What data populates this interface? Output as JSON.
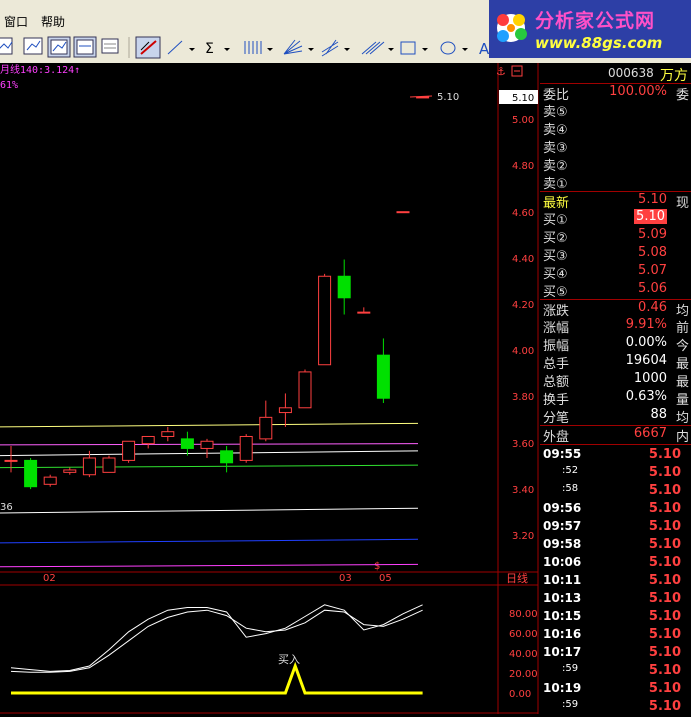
{
  "menu": {
    "window": "窗口",
    "help": "帮助"
  },
  "logo": {
    "title": "分析家公式网",
    "url": "www.88gs.com"
  },
  "header": {
    "ma_label": "月线140:3.124↑",
    "pct_label": "61%",
    "sell_icon": "sell-marker-icon"
  },
  "price_axis": {
    "labels": [
      "5.10",
      "5.00",
      "4.80",
      "4.60",
      "4.40",
      "4.20",
      "4.00",
      "3.80",
      "3.60",
      "3.40",
      "3.20"
    ]
  },
  "time_axis": {
    "labels": [
      "02",
      "03",
      "05"
    ],
    "period": "日线"
  },
  "left_edge_label": "36",
  "indicator": {
    "signal_label": "买入",
    "axis_labels": [
      "80.00",
      "60.00",
      "40.00",
      "20.00",
      "0.00"
    ]
  },
  "quote": {
    "code": "000638",
    "name": "万方",
    "weibi": {
      "label": "委比",
      "value": "100.00%",
      "ext": "委"
    },
    "sells": [
      {
        "label": "卖⑤",
        "price": ""
      },
      {
        "label": "卖④",
        "price": ""
      },
      {
        "label": "卖③",
        "price": ""
      },
      {
        "label": "卖②",
        "price": ""
      },
      {
        "label": "卖①",
        "price": ""
      }
    ],
    "latest": {
      "label": "最新",
      "value": "5.10",
      "ext": "现"
    },
    "buys": [
      {
        "label": "买①",
        "price": "5.10"
      },
      {
        "label": "买②",
        "price": "5.09"
      },
      {
        "label": "买③",
        "price": "5.08"
      },
      {
        "label": "买④",
        "price": "5.07"
      },
      {
        "label": "买⑤",
        "price": "5.06"
      }
    ],
    "stats": [
      {
        "label": "涨跌",
        "value": "0.46",
        "ext": "均",
        "color": "#ff4040"
      },
      {
        "label": "涨幅",
        "value": "9.91%",
        "ext": "前",
        "color": "#ff4040"
      },
      {
        "label": "振幅",
        "value": "0.00%",
        "ext": "今",
        "color": "#ffffff"
      },
      {
        "label": "总手",
        "value": "19604",
        "ext": "最",
        "color": "#ffffff"
      },
      {
        "label": "总额",
        "value": "1000",
        "ext": "最",
        "color": "#ffffff"
      },
      {
        "label": "换手",
        "value": "0.63%",
        "ext": "量",
        "color": "#ffffff"
      },
      {
        "label": "分笔",
        "value": "88",
        "ext": "均",
        "color": "#ffffff"
      },
      {
        "label": "外盘",
        "value": "6667",
        "ext": "内",
        "color": "#ff4040"
      }
    ],
    "ticks": [
      {
        "time": "09:55",
        "price": "5.10"
      },
      {
        "time": ":52",
        "price": "5.10"
      },
      {
        "time": ":58",
        "price": "5.10"
      },
      {
        "time": "09:56",
        "price": "5.10"
      },
      {
        "time": "09:57",
        "price": "5.10"
      },
      {
        "time": "09:58",
        "price": "5.10"
      },
      {
        "time": "10:06",
        "price": "5.10"
      },
      {
        "time": "10:11",
        "price": "5.10"
      },
      {
        "time": "10:13",
        "price": "5.10"
      },
      {
        "time": "10:15",
        "price": "5.10"
      },
      {
        "time": "10:16",
        "price": "5.10"
      },
      {
        "time": "10:17",
        "price": "5.10"
      },
      {
        "time": ":59",
        "price": "5.10"
      },
      {
        "time": "10:19",
        "price": "5.10"
      },
      {
        "time": ":59",
        "price": "5.10"
      }
    ]
  },
  "chart_data": [
    {
      "type": "candlestick",
      "ylim": [
        3.13,
        5.2
      ],
      "candles": [
        {
          "o": 3.58,
          "h": 3.64,
          "l": 3.53,
          "c": 3.58
        },
        {
          "o": 3.58,
          "h": 3.59,
          "l": 3.46,
          "c": 3.47
        },
        {
          "o": 3.48,
          "h": 3.52,
          "l": 3.47,
          "c": 3.51
        },
        {
          "o": 3.53,
          "h": 3.55,
          "l": 3.52,
          "c": 3.54
        },
        {
          "o": 3.52,
          "h": 3.62,
          "l": 3.51,
          "c": 3.59
        },
        {
          "o": 3.53,
          "h": 3.6,
          "l": 3.53,
          "c": 3.59
        },
        {
          "o": 3.58,
          "h": 3.66,
          "l": 3.57,
          "c": 3.66
        },
        {
          "o": 3.65,
          "h": 3.68,
          "l": 3.63,
          "c": 3.68
        },
        {
          "o": 3.68,
          "h": 3.72,
          "l": 3.66,
          "c": 3.7
        },
        {
          "o": 3.67,
          "h": 3.7,
          "l": 3.6,
          "c": 3.63
        },
        {
          "o": 3.63,
          "h": 3.67,
          "l": 3.59,
          "c": 3.66
        },
        {
          "o": 3.62,
          "h": 3.64,
          "l": 3.53,
          "c": 3.57
        },
        {
          "o": 3.58,
          "h": 3.69,
          "l": 3.57,
          "c": 3.68
        },
        {
          "o": 3.67,
          "h": 3.83,
          "l": 3.66,
          "c": 3.76
        },
        {
          "o": 3.78,
          "h": 3.86,
          "l": 3.72,
          "c": 3.8
        },
        {
          "o": 3.8,
          "h": 3.96,
          "l": 3.8,
          "c": 3.95
        },
        {
          "o": 3.98,
          "h": 4.36,
          "l": 3.98,
          "c": 4.35
        },
        {
          "o": 4.35,
          "h": 4.42,
          "l": 4.19,
          "c": 4.26
        },
        {
          "o": 4.2,
          "h": 4.22,
          "l": 4.2,
          "c": 4.2
        },
        {
          "o": 4.02,
          "h": 4.09,
          "l": 3.82,
          "c": 3.84
        },
        {
          "o": 4.62,
          "h": 4.62,
          "l": 4.62,
          "c": 4.62
        },
        {
          "o": 5.1,
          "h": 5.1,
          "l": 5.1,
          "c": 5.1
        }
      ],
      "lines": [
        {
          "color": "#ffff80",
          "values": [
            3.72,
            3.735
          ]
        },
        {
          "color": "#ff60ff",
          "values": [
            3.645,
            3.65
          ]
        },
        {
          "color": "#ffffff",
          "values": [
            3.6,
            3.62
          ]
        },
        {
          "color": "#30e030",
          "values": [
            3.55,
            3.56
          ]
        },
        {
          "color": "#ffffff",
          "values": [
            3.36,
            3.38
          ]
        },
        {
          "color": "#2040ff",
          "values": [
            3.235,
            3.25
          ]
        },
        {
          "color": "#ff40ff",
          "values": [
            3.135,
            3.145
          ]
        }
      ]
    },
    {
      "type": "line",
      "ylim": [
        0,
        100
      ],
      "series": [
        {
          "color": "#ffffff",
          "values": [
            28,
            26,
            24,
            25,
            30,
            48,
            68,
            82,
            92,
            95,
            95,
            90,
            62,
            66,
            72,
            85,
            98,
            92,
            70,
            76,
            88,
            98
          ]
        },
        {
          "color": "#ffffff",
          "values": [
            24,
            23,
            23,
            24,
            28,
            42,
            58,
            74,
            84,
            90,
            92,
            86,
            72,
            68,
            70,
            78,
            92,
            90,
            76,
            74,
            82,
            92
          ]
        },
        {
          "color": "#ffff00",
          "values": [
            0,
            0,
            0,
            0,
            0,
            0,
            0,
            0,
            0,
            0,
            0,
            0,
            0,
            0,
            0,
            0,
            0,
            0,
            0,
            0,
            0,
            0
          ],
          "signal_index": 14,
          "signal_value": 30
        }
      ]
    }
  ]
}
